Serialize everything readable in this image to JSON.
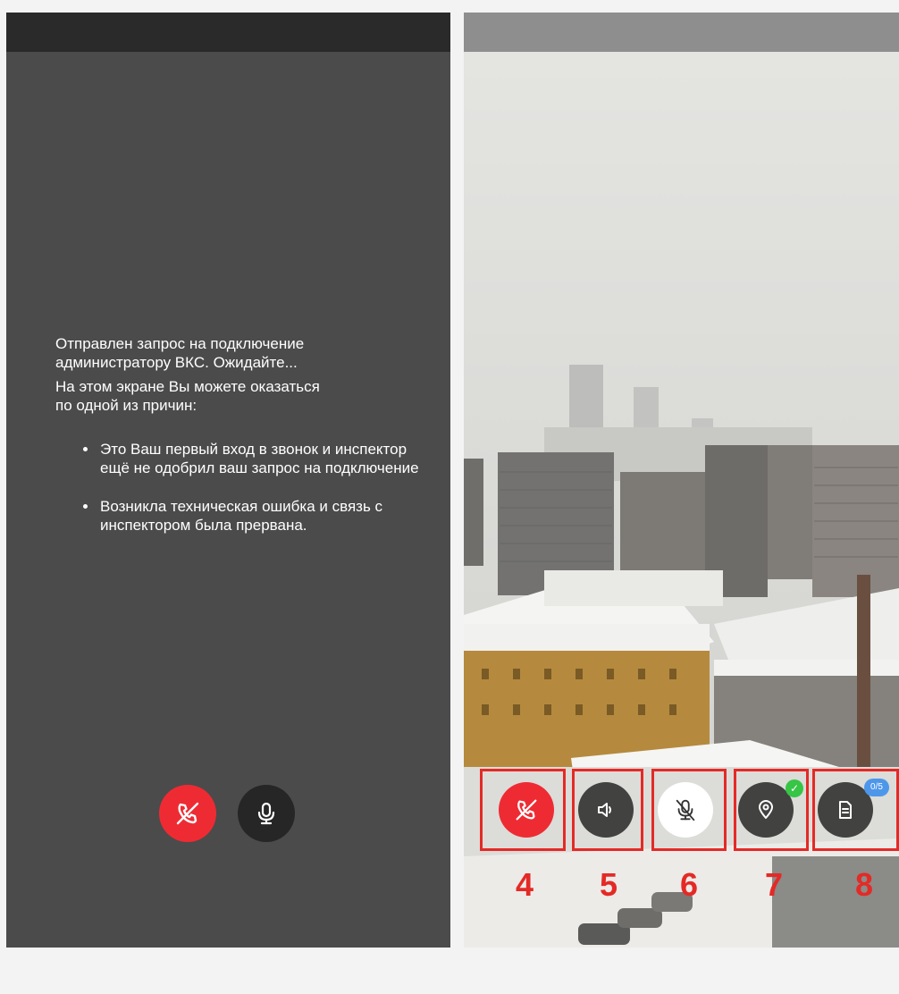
{
  "waiting_screen": {
    "line1": "Отправлен запрос на подключение",
    "line2": "администратору ВКС. Ожидайте...",
    "line3": "На этом экране Вы можете оказаться",
    "line4": "по одной из причин:",
    "reasons": [
      "Это Ваш первый вход в звонок и инспектор ещё не одобрил ваш запрос на подключение",
      "Возникла техническая ошибка и связь с инспектором была прервана."
    ],
    "controls": [
      {
        "icon": "hang-up-icon",
        "color": "#ee2b33"
      },
      {
        "icon": "microphone-icon",
        "color": "#262626"
      }
    ]
  },
  "call_screen": {
    "controls": [
      {
        "number": "4",
        "icon": "hang-up-icon",
        "color": "#ee2b33"
      },
      {
        "number": "5",
        "icon": "speaker-icon",
        "color": "#202020"
      },
      {
        "number": "6",
        "icon": "microphone-muted-icon",
        "color": "#ffffff"
      },
      {
        "number": "7",
        "icon": "location-pin-icon",
        "color": "#202020",
        "badge": "✓"
      },
      {
        "number": "8",
        "icon": "document-icon",
        "color": "#202020",
        "badge": "0/5"
      }
    ],
    "highlight_color": "#e42a26"
  }
}
